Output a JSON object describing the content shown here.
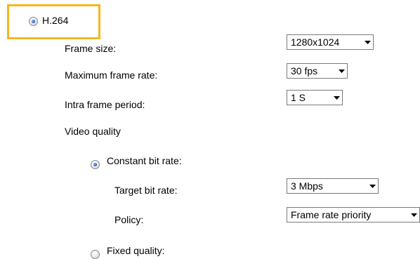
{
  "codec": {
    "label": "H.264",
    "selected": true
  },
  "frame_size": {
    "label": "Frame size:",
    "value": "1280x1024"
  },
  "max_frame_rate": {
    "label": "Maximum frame rate:",
    "value": "30 fps"
  },
  "intra_frame_period": {
    "label": "Intra frame period:",
    "value": "1 S"
  },
  "video_quality": {
    "label": "Video quality",
    "constant_bit_rate": {
      "label": "Constant bit rate:",
      "selected": true,
      "target_bit_rate": {
        "label": "Target bit rate:",
        "value": "3 Mbps"
      },
      "policy": {
        "label": "Policy:",
        "value": "Frame rate priority"
      }
    },
    "fixed_quality": {
      "label": "Fixed quality:",
      "selected": false
    }
  },
  "colors": {
    "highlight": "#f5b71e"
  },
  "icons": {
    "dropdown": "chevron-down-icon"
  }
}
